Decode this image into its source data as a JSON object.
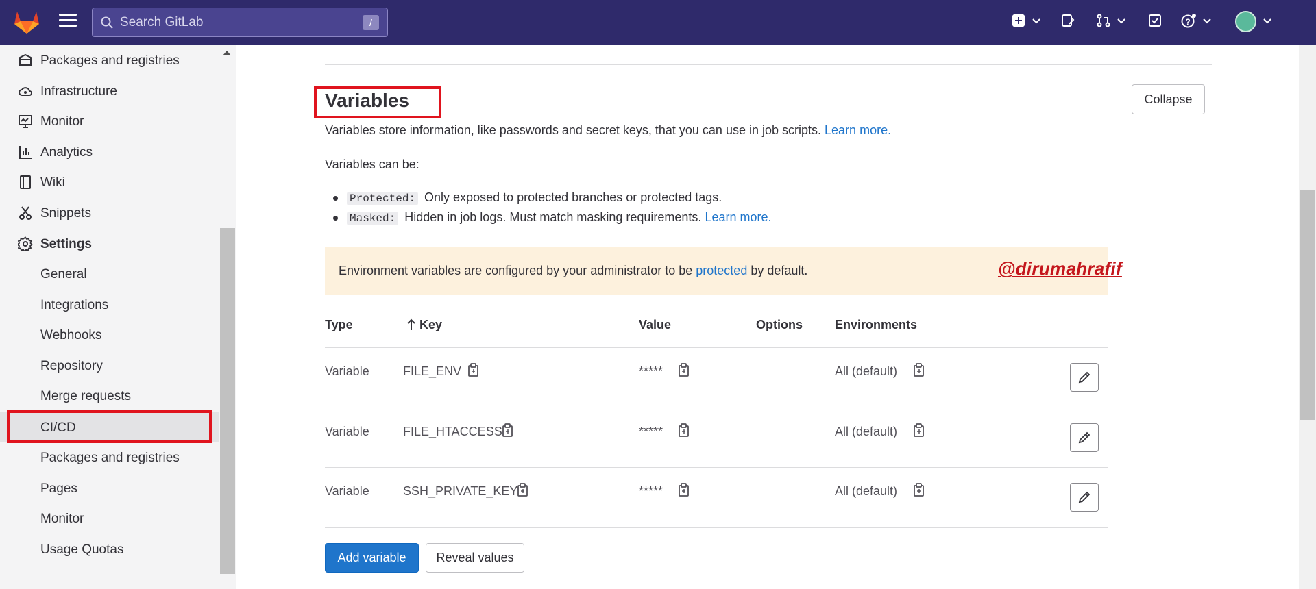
{
  "topbar": {
    "search_placeholder": "Search GitLab",
    "search_shortcut": "/"
  },
  "sidebar": {
    "items": [
      {
        "label": "Packages and registries",
        "icon": "package-icon"
      },
      {
        "label": "Infrastructure",
        "icon": "cloud-icon"
      },
      {
        "label": "Monitor",
        "icon": "monitor-icon"
      },
      {
        "label": "Analytics",
        "icon": "chart-icon"
      },
      {
        "label": "Wiki",
        "icon": "book-icon"
      },
      {
        "label": "Snippets",
        "icon": "scissors-icon"
      },
      {
        "label": "Settings",
        "icon": "gear-icon"
      }
    ],
    "settings_items": [
      "General",
      "Integrations",
      "Webhooks",
      "Repository",
      "Merge requests",
      "CI/CD",
      "Packages and registries",
      "Pages",
      "Monitor",
      "Usage Quotas"
    ],
    "active_item": "CI/CD"
  },
  "variables": {
    "title": "Variables",
    "collapse_label": "Collapse",
    "description": "Variables store information, like passwords and secret keys, that you can use in job scripts.",
    "learn_more": "Learn more.",
    "can_be": "Variables can be:",
    "protected_code": "Protected:",
    "protected_text": "Only exposed to protected branches or protected tags.",
    "masked_code": "Masked:",
    "masked_text": "Hidden in job logs. Must match masking requirements.",
    "alert_before": "Environment variables are configured by your administrator to be",
    "alert_link": "protected",
    "alert_after": "by default.",
    "watermark": "@dirumahrafif",
    "columns": {
      "type": "Type",
      "key": "Key",
      "value": "Value",
      "options": "Options",
      "environments": "Environments"
    },
    "rows": [
      {
        "type": "Variable",
        "key": "FILE_ENV",
        "value": "*****",
        "environment": "All (default)"
      },
      {
        "type": "Variable",
        "key": "FILE_HTACCESS",
        "value": "*****",
        "environment": "All (default)"
      },
      {
        "type": "Variable",
        "key": "SSH_PRIVATE_KEY",
        "value": "*****",
        "environment": "All (default)"
      }
    ],
    "add_label": "Add variable",
    "reveal_label": "Reveal values"
  },
  "colors": {
    "topbar": "#2f2a6b",
    "link": "#1f75cb",
    "alert_bg": "#fdf1dd",
    "highlight": "#e0141e"
  }
}
